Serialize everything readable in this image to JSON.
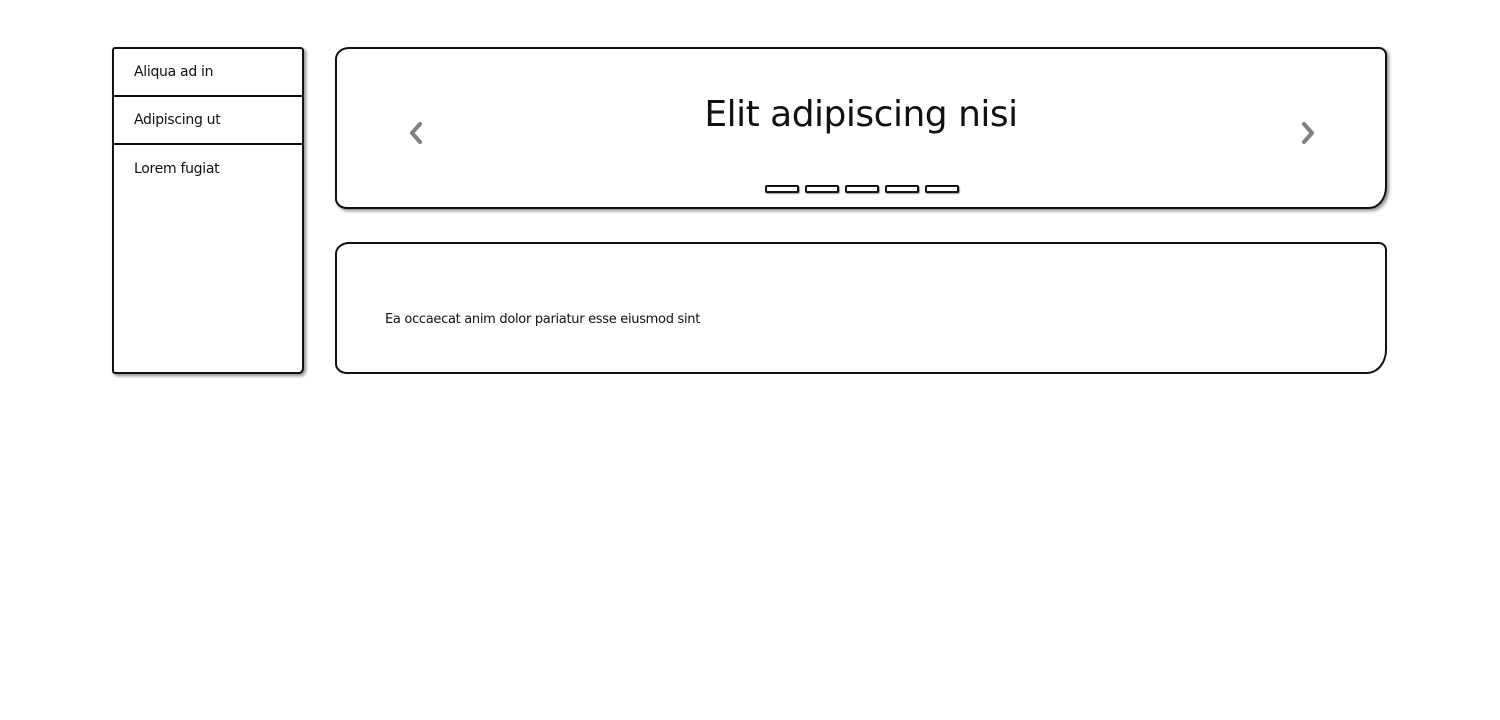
{
  "sidebar": {
    "items": [
      {
        "label": "Aliqua ad in"
      },
      {
        "label": "Adipiscing ut"
      },
      {
        "label": "Lorem fugiat"
      }
    ]
  },
  "carousel": {
    "title": "Elit adipiscing nisi",
    "prev_icon": "chevron-left-icon",
    "next_icon": "chevron-right-icon",
    "indicator_count": 5
  },
  "content": {
    "text": "Ea occaecat anim dolor pariatur esse eiusmod sint"
  },
  "colors": {
    "border": "#111111",
    "arrow": "#808080",
    "background": "#ffffff"
  }
}
